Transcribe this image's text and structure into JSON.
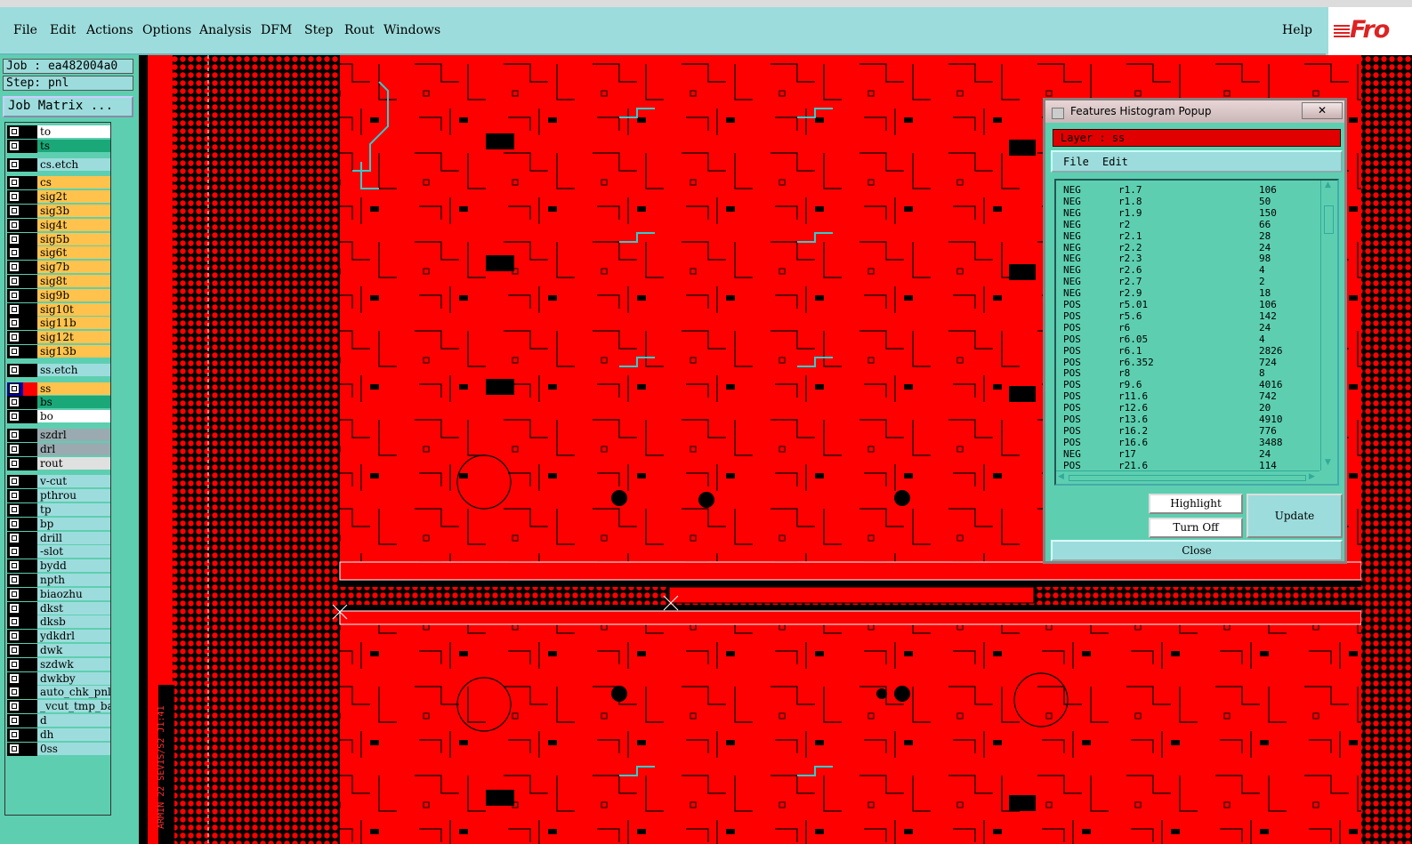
{
  "menubar": {
    "items": [
      "File",
      "Edit",
      "Actions",
      "Options",
      "Analysis",
      "DFM",
      "Step",
      "Rout",
      "Windows"
    ],
    "help": "Help"
  },
  "logo_text": "Fro",
  "job": {
    "job_label": "Job : ea482004a0",
    "step_label": "Step: pnl",
    "matrix_button": "Job Matrix ..."
  },
  "layers": [
    {
      "name": "to",
      "color": "#ffffff"
    },
    {
      "name": "ts",
      "color": "#1aa878"
    },
    {
      "name": "cs.etch",
      "color": "#9ddcdc"
    },
    {
      "name": "cs",
      "color": "#ffc34d"
    },
    {
      "name": "sig2t",
      "color": "#ffc34d"
    },
    {
      "name": "sig3b",
      "color": "#ffc34d"
    },
    {
      "name": "sig4t",
      "color": "#ffc34d"
    },
    {
      "name": "sig5b",
      "color": "#ffc34d"
    },
    {
      "name": "sig6t",
      "color": "#ffc34d"
    },
    {
      "name": "sig7b",
      "color": "#ffc34d"
    },
    {
      "name": "sig8t",
      "color": "#ffc34d"
    },
    {
      "name": "sig9b",
      "color": "#ffc34d"
    },
    {
      "name": "sig10t",
      "color": "#ffc34d"
    },
    {
      "name": "sig11b",
      "color": "#ffc34d"
    },
    {
      "name": "sig12t",
      "color": "#ffc34d"
    },
    {
      "name": "sig13b",
      "color": "#ffc34d"
    },
    {
      "name": "ss.etch",
      "color": "#9ddcdc"
    },
    {
      "name": "ss",
      "color": "#ffc34d",
      "active": true
    },
    {
      "name": "bs",
      "color": "#1aa878"
    },
    {
      "name": "bo",
      "color": "#ffffff"
    },
    {
      "name": "szdrl",
      "color": "#9aaab0"
    },
    {
      "name": "drl",
      "color": "#9aaab0"
    },
    {
      "name": "rout",
      "color": "#e0e0e0"
    },
    {
      "name": "v-cut",
      "color": "#9ddcdc"
    },
    {
      "name": "pthrou",
      "color": "#9ddcdc"
    },
    {
      "name": "tp",
      "color": "#9ddcdc"
    },
    {
      "name": "bp",
      "color": "#9ddcdc"
    },
    {
      "name": "drill",
      "color": "#9ddcdc"
    },
    {
      "name": "-slot",
      "color": "#9ddcdc"
    },
    {
      "name": "bydd",
      "color": "#9ddcdc"
    },
    {
      "name": "npth",
      "color": "#9ddcdc"
    },
    {
      "name": "biaozhu",
      "color": "#9ddcdc"
    },
    {
      "name": "dkst",
      "color": "#9ddcdc"
    },
    {
      "name": "dksb",
      "color": "#9ddcdc"
    },
    {
      "name": "ydkdrl",
      "color": "#9ddcdc"
    },
    {
      "name": "dwk",
      "color": "#9ddcdc"
    },
    {
      "name": "szdwk",
      "color": "#9ddcdc"
    },
    {
      "name": "dwkby",
      "color": "#9ddcdc"
    },
    {
      "name": "auto_chk_pnl",
      "color": "#9ddcdc"
    },
    {
      "name": "_vcut_tmp_ba",
      "color": "#9ddcdc"
    },
    {
      "name": "d",
      "color": "#9ddcdc"
    },
    {
      "name": "dh",
      "color": "#9ddcdc"
    },
    {
      "name": "0ss",
      "color": "#9ddcdc"
    }
  ],
  "popup": {
    "title": "Features Histogram Popup",
    "close_x": "✕",
    "layer_field": "Layer :  ss",
    "menu_file": "File",
    "menu_edit": "Edit",
    "rows": [
      [
        "NEG",
        "r1.7",
        "106"
      ],
      [
        "NEG",
        "r1.8",
        "50"
      ],
      [
        "NEG",
        "r1.9",
        "150"
      ],
      [
        "NEG",
        "r2",
        "66"
      ],
      [
        "NEG",
        "r2.1",
        "28"
      ],
      [
        "NEG",
        "r2.2",
        "24"
      ],
      [
        "NEG",
        "r2.3",
        "98"
      ],
      [
        "NEG",
        "r2.6",
        "4"
      ],
      [
        "NEG",
        "r2.7",
        "2"
      ],
      [
        "NEG",
        "r2.9",
        "18"
      ],
      [
        "POS",
        "r5.01",
        "106"
      ],
      [
        "POS",
        "r5.6",
        "142"
      ],
      [
        "POS",
        "r6",
        "24"
      ],
      [
        "POS",
        "r6.05",
        "4"
      ],
      [
        "POS",
        "r6.1",
        "2826"
      ],
      [
        "POS",
        "r6.352",
        "724"
      ],
      [
        "POS",
        "r8",
        "8"
      ],
      [
        "POS",
        "r9.6",
        "4016"
      ],
      [
        "POS",
        "r11.6",
        "742"
      ],
      [
        "POS",
        "r12.6",
        "20"
      ],
      [
        "POS",
        "r13.6",
        "4910"
      ],
      [
        "POS",
        "r16.2",
        "776"
      ],
      [
        "POS",
        "r16.6",
        "3488"
      ],
      [
        "NEG",
        "r17",
        "24"
      ],
      [
        "POS",
        "r21.6",
        "114"
      ]
    ],
    "highlight_button": "Highlight",
    "turnoff_button": "Turn Off",
    "update_button": "Update",
    "close_button": "Close"
  },
  "canvas_label": "ARMIN 22 SEVIS/S2 J1:41",
  "colors": {
    "board": "#ff0000",
    "background": "#000000",
    "panel": "#5dcfb0",
    "menubar": "#9ddcdc"
  }
}
